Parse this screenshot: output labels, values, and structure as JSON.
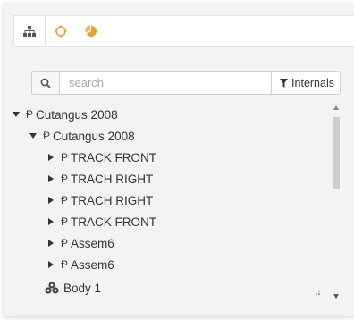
{
  "tabs": [
    {
      "name": "hierarchy",
      "icon": "sitemap-icon"
    },
    {
      "name": "origin",
      "icon": "circle-outline-icon"
    },
    {
      "name": "mass",
      "icon": "pie-chart-icon"
    }
  ],
  "search": {
    "placeholder": "search",
    "filter_label": "Internals"
  },
  "tree": [
    {
      "label": "Cutangus 2008",
      "level": 0,
      "expanded": true,
      "type": "assembly"
    },
    {
      "label": "Cutangus 2008",
      "level": 1,
      "expanded": true,
      "type": "assembly"
    },
    {
      "label": "TRACK FRONT",
      "level": 2,
      "expanded": false,
      "type": "assembly"
    },
    {
      "label": "TRACH RIGHT",
      "level": 2,
      "expanded": false,
      "type": "assembly"
    },
    {
      "label": "TRACH RIGHT",
      "level": 2,
      "expanded": false,
      "type": "assembly"
    },
    {
      "label": "TRACK FRONT",
      "level": 2,
      "expanded": false,
      "type": "assembly"
    },
    {
      "label": "Assem6",
      "level": 2,
      "expanded": false,
      "type": "assembly"
    },
    {
      "label": "Assem6",
      "level": 2,
      "expanded": false,
      "type": "assembly"
    },
    {
      "label": "Body 1",
      "level": 2,
      "expanded": null,
      "type": "body"
    }
  ],
  "colors": {
    "accent": "#f0a030",
    "tab_icon_dark": "#5a5a5a"
  }
}
